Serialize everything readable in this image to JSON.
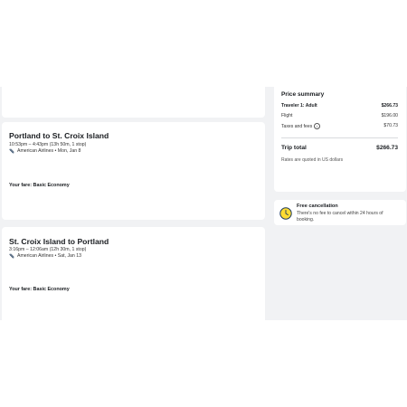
{
  "flights": [
    {
      "route": "Portland to St. Croix Island",
      "times": "10:53pm – 4:43pm (13h 50m, 1 stop)",
      "airline": "American Airlines • Mon, Jan 8",
      "fare": "Your fare: Basic Economy"
    },
    {
      "route": "St. Croix Island to Portland",
      "times": "3:16pm – 12:06am (12h 30m, 1 stop)",
      "airline": "American Airlines • Sat, Jan 13",
      "fare": "Your fare: Basic Economy"
    }
  ],
  "price_summary": {
    "title": "Price summary",
    "traveler_label": "Traveler 1: Adult",
    "traveler_amount": "$266.73",
    "flight_label": "Flight",
    "flight_amount": "$196.00",
    "taxes_label": "Taxes and fees",
    "taxes_amount": "$70.73",
    "total_label": "Trip total",
    "total_amount": "$266.73",
    "note": "Rates are quoted in US dollars"
  },
  "cancellation": {
    "title": "Free cancellation",
    "text": "There's no fee to cancel within 24 hours of booking."
  },
  "colors": {
    "page_background": "#f1f2f4",
    "airline_logo": "#1f3b5c",
    "cancel_icon_fill": "#fddb32"
  },
  "icons": {
    "airline": "airline-logo-icon",
    "info": "info-icon",
    "cancellation": "clock-icon"
  }
}
